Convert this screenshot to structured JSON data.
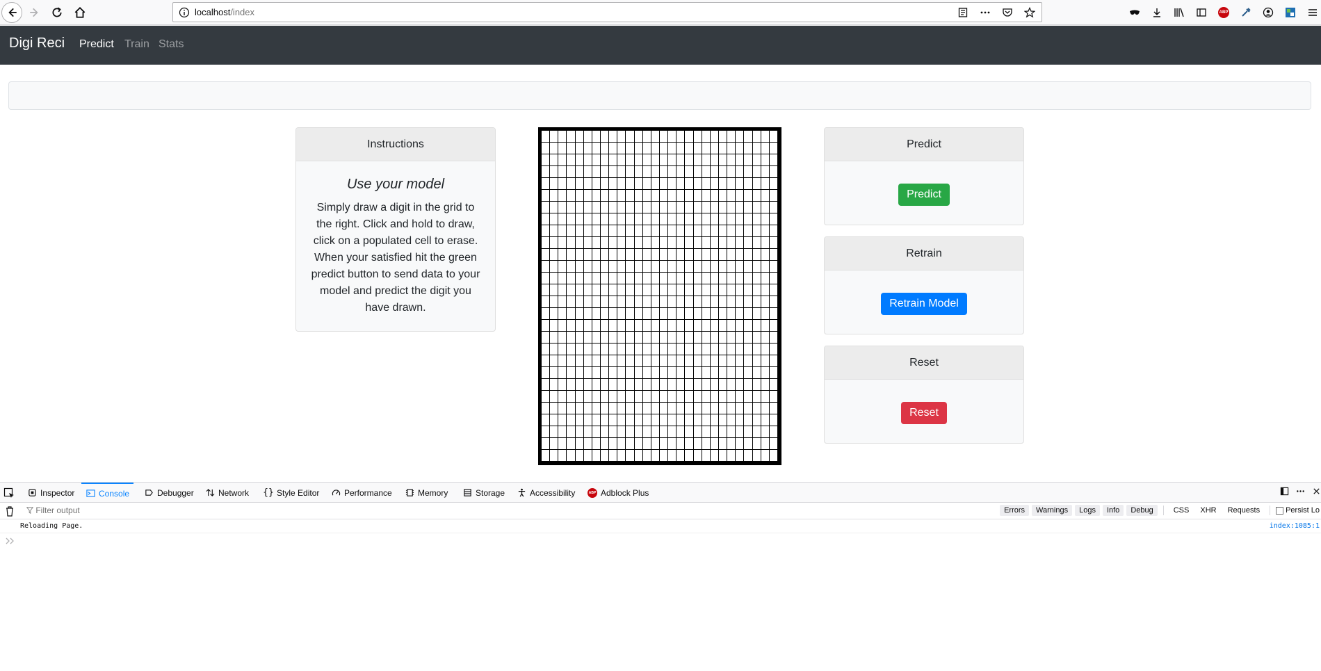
{
  "browser": {
    "url_host": "localhost",
    "url_path": "/index"
  },
  "navbar": {
    "brand": "Digi Reci",
    "links": [
      "Predict",
      "Train",
      "Stats"
    ]
  },
  "instructions": {
    "header": "Instructions",
    "title": "Use your model",
    "text": "Simply draw a digit in the grid to the right. Click and hold to draw, click on a populated cell to erase. When your satisfied hit the green predict button to send data to your model and predict the digit you have drawn."
  },
  "grid": {
    "rows": 28,
    "cols": 28
  },
  "predict_card": {
    "header": "Predict",
    "button": "Predict"
  },
  "retrain_card": {
    "header": "Retrain",
    "button": "Retrain Model"
  },
  "reset_card": {
    "header": "Reset",
    "button": "Reset"
  },
  "colors": {
    "success": "#28a745",
    "primary": "#007bff",
    "danger": "#dc3545",
    "navbar": "#343a40"
  },
  "devtools": {
    "tabs": [
      "Inspector",
      "Console",
      "Debugger",
      "Network",
      "Style Editor",
      "Performance",
      "Memory",
      "Storage",
      "Accessibility",
      "Adblock Plus"
    ],
    "active_tab": "Console",
    "filter_placeholder": "Filter output",
    "filters": [
      "Errors",
      "Warnings",
      "Logs",
      "Info",
      "Debug",
      "CSS",
      "XHR",
      "Requests"
    ],
    "persist_label": "Persist Lo",
    "log": {
      "message": "Reloading Page.",
      "source": "index:1085:1"
    }
  }
}
